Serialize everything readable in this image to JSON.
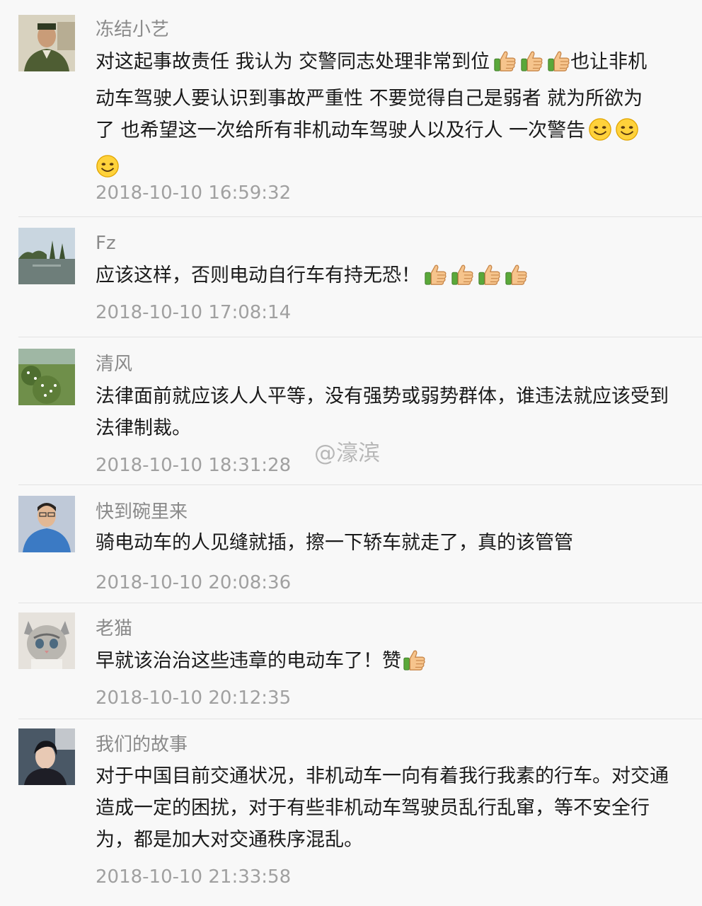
{
  "comments": [
    {
      "name": "冻结小艺",
      "text_lines": [
        "对这起事故责任 我认为 交警同志处理非常到位",
        "动车驾驶人要认识到事故严重性 不要觉得自己是弱者 就为所欲为",
        "了 也希望这一次给所有非机动车驾驶人以及行人 一次警告"
      ],
      "text_after_thumbs": "也让非机",
      "time": "2018-10-10 16:59:32",
      "emoji": [
        "thumbs-up",
        "thumbs-up",
        "thumbs-up",
        "smiley",
        "smiley",
        "smiley"
      ]
    },
    {
      "name": "Fz",
      "text": "应该这样，否则电动自行车有持无恐！",
      "time": "2018-10-10 17:08:14",
      "emoji": [
        "thumbs-up",
        "thumbs-up",
        "thumbs-up",
        "thumbs-up"
      ]
    },
    {
      "name": "清风",
      "text": "法律面前就应该人人平等，没有强势或弱势群体，谁违法就应该受到法律制裁。",
      "time": "2018-10-10 18:31:28"
    },
    {
      "name": "快到碗里来",
      "text": "骑电动车的人见缝就插，擦一下轿车就走了，真的该管管",
      "time": "2018-10-10 20:08:36"
    },
    {
      "name": "老猫",
      "text": "早就该治治这些违章的电动车了！赞",
      "time": "2018-10-10 20:12:35",
      "emoji": [
        "thumbs-up"
      ]
    },
    {
      "name": "我们的故事",
      "text": "对于中国目前交通状况，非机动车一向有着我行我素的行车。对交通造成一定的困扰，对于有些非机动车驾驶员乱行乱窜，等不安全行为，都是加大对交通秩序混乱。",
      "time": "2018-10-10 21:33:58"
    }
  ],
  "watermark": "@濠滨",
  "colors": {
    "name": "#8a8a8a",
    "text": "#1a1a1a",
    "time": "#a0a0a0",
    "background": "#f8f8f8"
  }
}
